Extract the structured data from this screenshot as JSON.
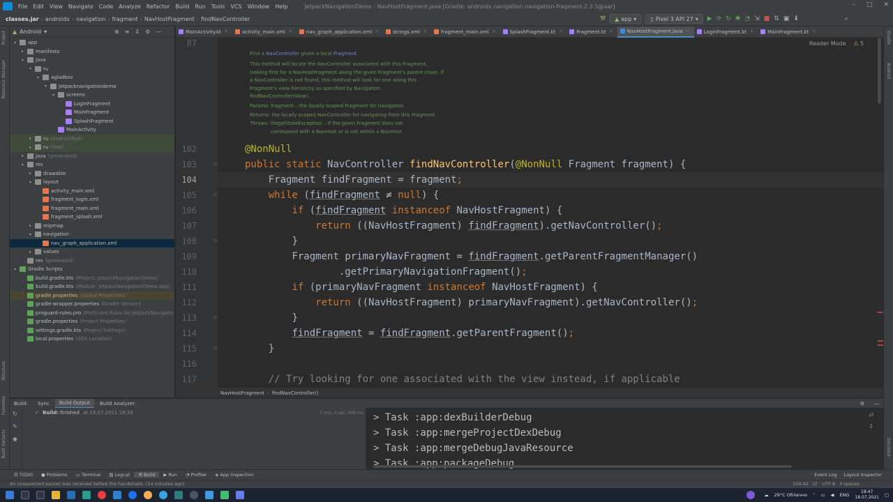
{
  "menubar": {
    "items": [
      "File",
      "Edit",
      "View",
      "Navigate",
      "Code",
      "Analyze",
      "Refactor",
      "Build",
      "Run",
      "Tools",
      "VCS",
      "Window",
      "Help"
    ],
    "title": "JetpackNavigationDemo - NavHostFragment.java [Gradle: androidx.navigation:navigation-fragment:2.3.5@aar]"
  },
  "navbar": {
    "crumbs": [
      "classes.jar",
      "androidx",
      "navigation",
      "fragment",
      "NavHostFragment",
      "findNavController"
    ],
    "run_config": "app",
    "device": "Pixel 3 API 27"
  },
  "project": {
    "view_label": "Android",
    "tree": [
      {
        "label": "app",
        "hint": "",
        "depth": 0,
        "arrow": "▾",
        "icon": "folder"
      },
      {
        "label": "manifests",
        "hint": "",
        "depth": 1,
        "arrow": "▸",
        "icon": "folder"
      },
      {
        "label": "java",
        "hint": "",
        "depth": 1,
        "arrow": "▾",
        "icon": "folder"
      },
      {
        "label": "ru",
        "hint": "",
        "depth": 2,
        "arrow": "▾",
        "icon": "package"
      },
      {
        "label": "agladkov",
        "hint": "",
        "depth": 3,
        "arrow": "▾",
        "icon": "package"
      },
      {
        "label": "jetpacknavigationdemo",
        "hint": "",
        "depth": 4,
        "arrow": "▾",
        "icon": "package"
      },
      {
        "label": "screens",
        "hint": "",
        "depth": 5,
        "arrow": "▾",
        "icon": "package"
      },
      {
        "label": "LoginFragment",
        "hint": "",
        "depth": 6,
        "arrow": "",
        "icon": "kotlin"
      },
      {
        "label": "MainFragment",
        "hint": "",
        "depth": 6,
        "arrow": "",
        "icon": "kotlin"
      },
      {
        "label": "SplashFragment",
        "hint": "",
        "depth": 6,
        "arrow": "",
        "icon": "kotlin"
      },
      {
        "label": "MainActivity",
        "hint": "",
        "depth": 5,
        "arrow": "",
        "icon": "kotlin"
      },
      {
        "label": "ru",
        "hint": "(androidTest)",
        "depth": 2,
        "arrow": "▸",
        "icon": "package",
        "highlight": "green"
      },
      {
        "label": "ru",
        "hint": "(test)",
        "depth": 2,
        "arrow": "▸",
        "icon": "package",
        "highlight": "green"
      },
      {
        "label": "java",
        "hint": "(generated)",
        "depth": 1,
        "arrow": "▸",
        "icon": "folder"
      },
      {
        "label": "res",
        "hint": "",
        "depth": 1,
        "arrow": "▾",
        "icon": "folder"
      },
      {
        "label": "drawable",
        "hint": "",
        "depth": 2,
        "arrow": "▸",
        "icon": "folder"
      },
      {
        "label": "layout",
        "hint": "",
        "depth": 2,
        "arrow": "▾",
        "icon": "folder"
      },
      {
        "label": "activity_main.xml",
        "hint": "",
        "depth": 3,
        "arrow": "",
        "icon": "xml"
      },
      {
        "label": "fragment_login.xml",
        "hint": "",
        "depth": 3,
        "arrow": "",
        "icon": "xml"
      },
      {
        "label": "fragment_main.xml",
        "hint": "",
        "depth": 3,
        "arrow": "",
        "icon": "xml"
      },
      {
        "label": "fragment_splash.xml",
        "hint": "",
        "depth": 3,
        "arrow": "",
        "icon": "xml"
      },
      {
        "label": "mipmap",
        "hint": "",
        "depth": 2,
        "arrow": "▸",
        "icon": "folder"
      },
      {
        "label": "navigation",
        "hint": "",
        "depth": 2,
        "arrow": "▾",
        "icon": "folder"
      },
      {
        "label": "nav_graph_application.xml",
        "hint": "",
        "depth": 3,
        "arrow": "",
        "icon": "xml",
        "selected": true
      },
      {
        "label": "values",
        "hint": "",
        "depth": 2,
        "arrow": "▸",
        "icon": "folder"
      },
      {
        "label": "res",
        "hint": "(generated)",
        "depth": 1,
        "arrow": "",
        "icon": "folder"
      },
      {
        "label": "Gradle Scripts",
        "hint": "",
        "depth": 0,
        "arrow": "▾",
        "icon": "gradle"
      },
      {
        "label": "build.gradle.kts",
        "hint": "(Project: JetpackNavigationDemo)",
        "depth": 1,
        "arrow": "",
        "icon": "gradle"
      },
      {
        "label": "build.gradle.kts",
        "hint": "(Module: JetpackNavigationDemo.app)",
        "depth": 1,
        "arrow": "",
        "icon": "gradle"
      },
      {
        "label": "gradle.properties",
        "hint": "(Global Properties)",
        "depth": 1,
        "arrow": "",
        "icon": "gradle",
        "highlight": "yellow"
      },
      {
        "label": "gradle-wrapper.properties",
        "hint": "(Gradle Version)",
        "depth": 1,
        "arrow": "",
        "icon": "gradle"
      },
      {
        "label": "proguard-rules.pro",
        "hint": "(ProGuard Rules for JetpackNavigatio",
        "depth": 1,
        "arrow": "",
        "icon": "gradle"
      },
      {
        "label": "gradle.properties",
        "hint": "(Project Properties)",
        "depth": 1,
        "arrow": "",
        "icon": "gradle"
      },
      {
        "label": "settings.gradle.kts",
        "hint": "(Project Settings)",
        "depth": 1,
        "arrow": "",
        "icon": "gradle"
      },
      {
        "label": "local.properties",
        "hint": "(SDK Location)",
        "depth": 1,
        "arrow": "",
        "icon": "gradle"
      }
    ]
  },
  "tabs": [
    {
      "label": "MainActivity.kt",
      "icon": "kotlin"
    },
    {
      "label": "activity_main.xml",
      "icon": "xml"
    },
    {
      "label": "nav_graph_application.xml",
      "icon": "xml"
    },
    {
      "label": "strings.xml",
      "icon": "xml"
    },
    {
      "label": "fragment_main.xml",
      "icon": "xml"
    },
    {
      "label": "SplashFragment.kt",
      "icon": "kotlin"
    },
    {
      "label": "Fragment.kt",
      "icon": "kotlin"
    },
    {
      "label": "NavHostFragment.java",
      "icon": "java",
      "active": true
    },
    {
      "label": "LoginFragment.kt",
      "icon": "kotlin"
    },
    {
      "label": "MainFragment.kt",
      "icon": "kotlin"
    }
  ],
  "editor": {
    "reader_mode": "Reader Mode",
    "warnings": "5",
    "doc_line_number": "87",
    "doc": {
      "title_pre": "Find a ",
      "title_c1": "NavController",
      "title_mid": " given a local ",
      "title_c2": "Fragment",
      "body": [
        "This method will locate the NavController associated with this Fragment,",
        "looking first for a NavHostFragment along the given Fragment's parent chain. If",
        "a NavController is not found, this method will look for one along this",
        "Fragment's view hierarchy as specified by Navigation.",
        "findNavController(View)."
      ],
      "params": "Params: fragment – the locally scoped Fragment for navigation",
      "returns": "Returns: the locally scoped NavController for navigating from this Fragment",
      "throws": "Throws: IllegalStateException – if the given Fragment does not",
      "throws2": "correspond with a NavHost or is not within a NavHost."
    },
    "lines": [
      {
        "n": "102",
        "code": "@NonNull"
      },
      {
        "n": "103",
        "code": "public static NavController findNavController(@NonNull Fragment fragment) {"
      },
      {
        "n": "104",
        "code": "    Fragment findFragment = fragment;"
      },
      {
        "n": "105",
        "code": "    while (findFragment ≠ null) {"
      },
      {
        "n": "106",
        "code": "        if (findFragment instanceof NavHostFragment) {"
      },
      {
        "n": "107",
        "code": "            return ((NavHostFragment) findFragment).getNavController();"
      },
      {
        "n": "108",
        "code": "        }"
      },
      {
        "n": "109",
        "code": "        Fragment primaryNavFragment = findFragment.getParentFragmentManager()"
      },
      {
        "n": "110",
        "code": "                .getPrimaryNavigationFragment();"
      },
      {
        "n": "111",
        "code": "        if (primaryNavFragment instanceof NavHostFragment) {"
      },
      {
        "n": "112",
        "code": "            return ((NavHostFragment) primaryNavFragment).getNavController();"
      },
      {
        "n": "113",
        "code": "        }"
      },
      {
        "n": "114",
        "code": "        findFragment = findFragment.getParentFragment();"
      },
      {
        "n": "115",
        "code": "    }"
      },
      {
        "n": "116",
        "code": ""
      },
      {
        "n": "117",
        "code": "    // Try looking for one associated with the view instead, if applicable"
      }
    ],
    "breadcrumb": [
      "NavHostFragment",
      "findNavController()"
    ]
  },
  "build": {
    "tabs": [
      "Build:",
      "Sync",
      "Build Output",
      "Build Analyzer"
    ],
    "active_tab": "Build Output",
    "status_label": "Build:",
    "status_value": "finished",
    "status_time": "at 18.07.2021 18:33",
    "duration": "1 min, 6 sec, 648 ms",
    "output": [
      "> Task :app:dexBuilderDebug",
      "> Task :app:mergeProjectDexDebug",
      "> Task :app:mergeDebugJavaResource",
      "> Task :app:packageDebug"
    ]
  },
  "toolwindows": {
    "items": [
      "TODO",
      "Problems",
      "Terminal",
      "Logcat",
      "Build",
      "Run",
      "Profiler",
      "App Inspection"
    ],
    "active": "Build",
    "right": [
      "Event Log",
      "Layout Inspector"
    ]
  },
  "statusbar": {
    "message": "An unexpected packet was received before the handshake. (14 minutes ago)",
    "position": "104:42",
    "line_sep": "LF",
    "encoding": "UTF-8",
    "indent": "4 spaces"
  },
  "taskbar": {
    "weather": "29°C  Облачно",
    "lang": "ENG",
    "time": "18:47",
    "date": "18.07.2021"
  },
  "left_stripe": [
    "Project",
    "Resource Manager",
    "Structure",
    "Favorites",
    "Build Variants"
  ],
  "right_stripe": [
    "Gradle",
    "Android",
    "Emulator"
  ],
  "colors": {
    "kotlin": "#a97bff",
    "xml": "#e8754a",
    "java": "#3a8ee6",
    "folder": "#8f8f8f",
    "package": "#8f8f8f",
    "gradle": "#5fa35a"
  }
}
